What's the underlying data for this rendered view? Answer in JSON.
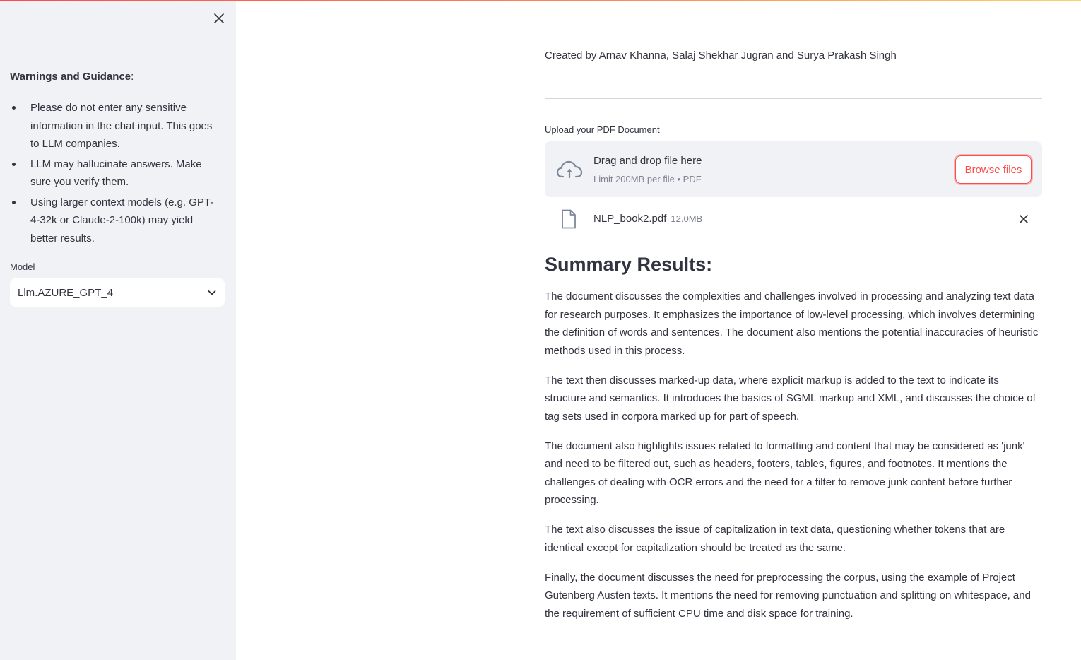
{
  "sidebar": {
    "guidance_title": "Warnings and Guidance",
    "guidance_colon": ":",
    "items": [
      "Please do not enter any sensitive information in the chat input. This goes to LLM companies.",
      "LLM may hallucinate answers. Make sure you verify them.",
      "Using larger context models (e.g. GPT-4-32k or Claude-2-100k) may yield better results."
    ],
    "model_label": "Model",
    "model_value": "Llm.AZURE_GPT_4"
  },
  "main": {
    "credits": "Created by Arnav Khanna, Salaj Shekhar Jugran and Surya Prakash Singh",
    "upload_label": "Upload your PDF Document",
    "dropzone": {
      "title": "Drag and drop file here",
      "limit": "Limit 200MB per file • PDF",
      "browse_label": "Browse files"
    },
    "file": {
      "name": "NLP_book2.pdf",
      "size": "12.0MB"
    },
    "summary_title": "Summary Results:",
    "summary_paragraphs": [
      "The document discusses the complexities and challenges involved in processing and analyzing text data for research purposes. It emphasizes the importance of low-level processing, which involves determining the definition of words and sentences. The document also mentions the potential inaccuracies of heuristic methods used in this process.",
      "The text then discusses marked-up data, where explicit markup is added to the text to indicate its structure and semantics. It introduces the basics of SGML markup and XML, and discusses the choice of tag sets used in corpora marked up for part of speech.",
      "The document also highlights issues related to formatting and content that may be considered as 'junk' and need to be filtered out, such as headers, footers, tables, figures, and footnotes. It mentions the challenges of dealing with OCR errors and the need for a filter to remove junk content before further processing.",
      "The text also discusses the issue of capitalization in text data, questioning whether tokens that are identical except for capitalization should be treated as the same.",
      "Finally, the document discusses the need for preprocessing the corpus, using the example of Project Gutenberg Austen texts. It mentions the need for removing punctuation and splitting on whitespace, and the requirement of sufficient CPU time and disk space for training."
    ]
  },
  "icons": {
    "close": "close-icon",
    "chevron": "chevron-down-icon",
    "cloud_upload": "cloud-upload-icon",
    "file": "file-icon"
  },
  "colors": {
    "accent": "#ff4b4b",
    "sidebar_bg": "#f0f2f6",
    "text": "#31333f",
    "muted": "#808495"
  }
}
